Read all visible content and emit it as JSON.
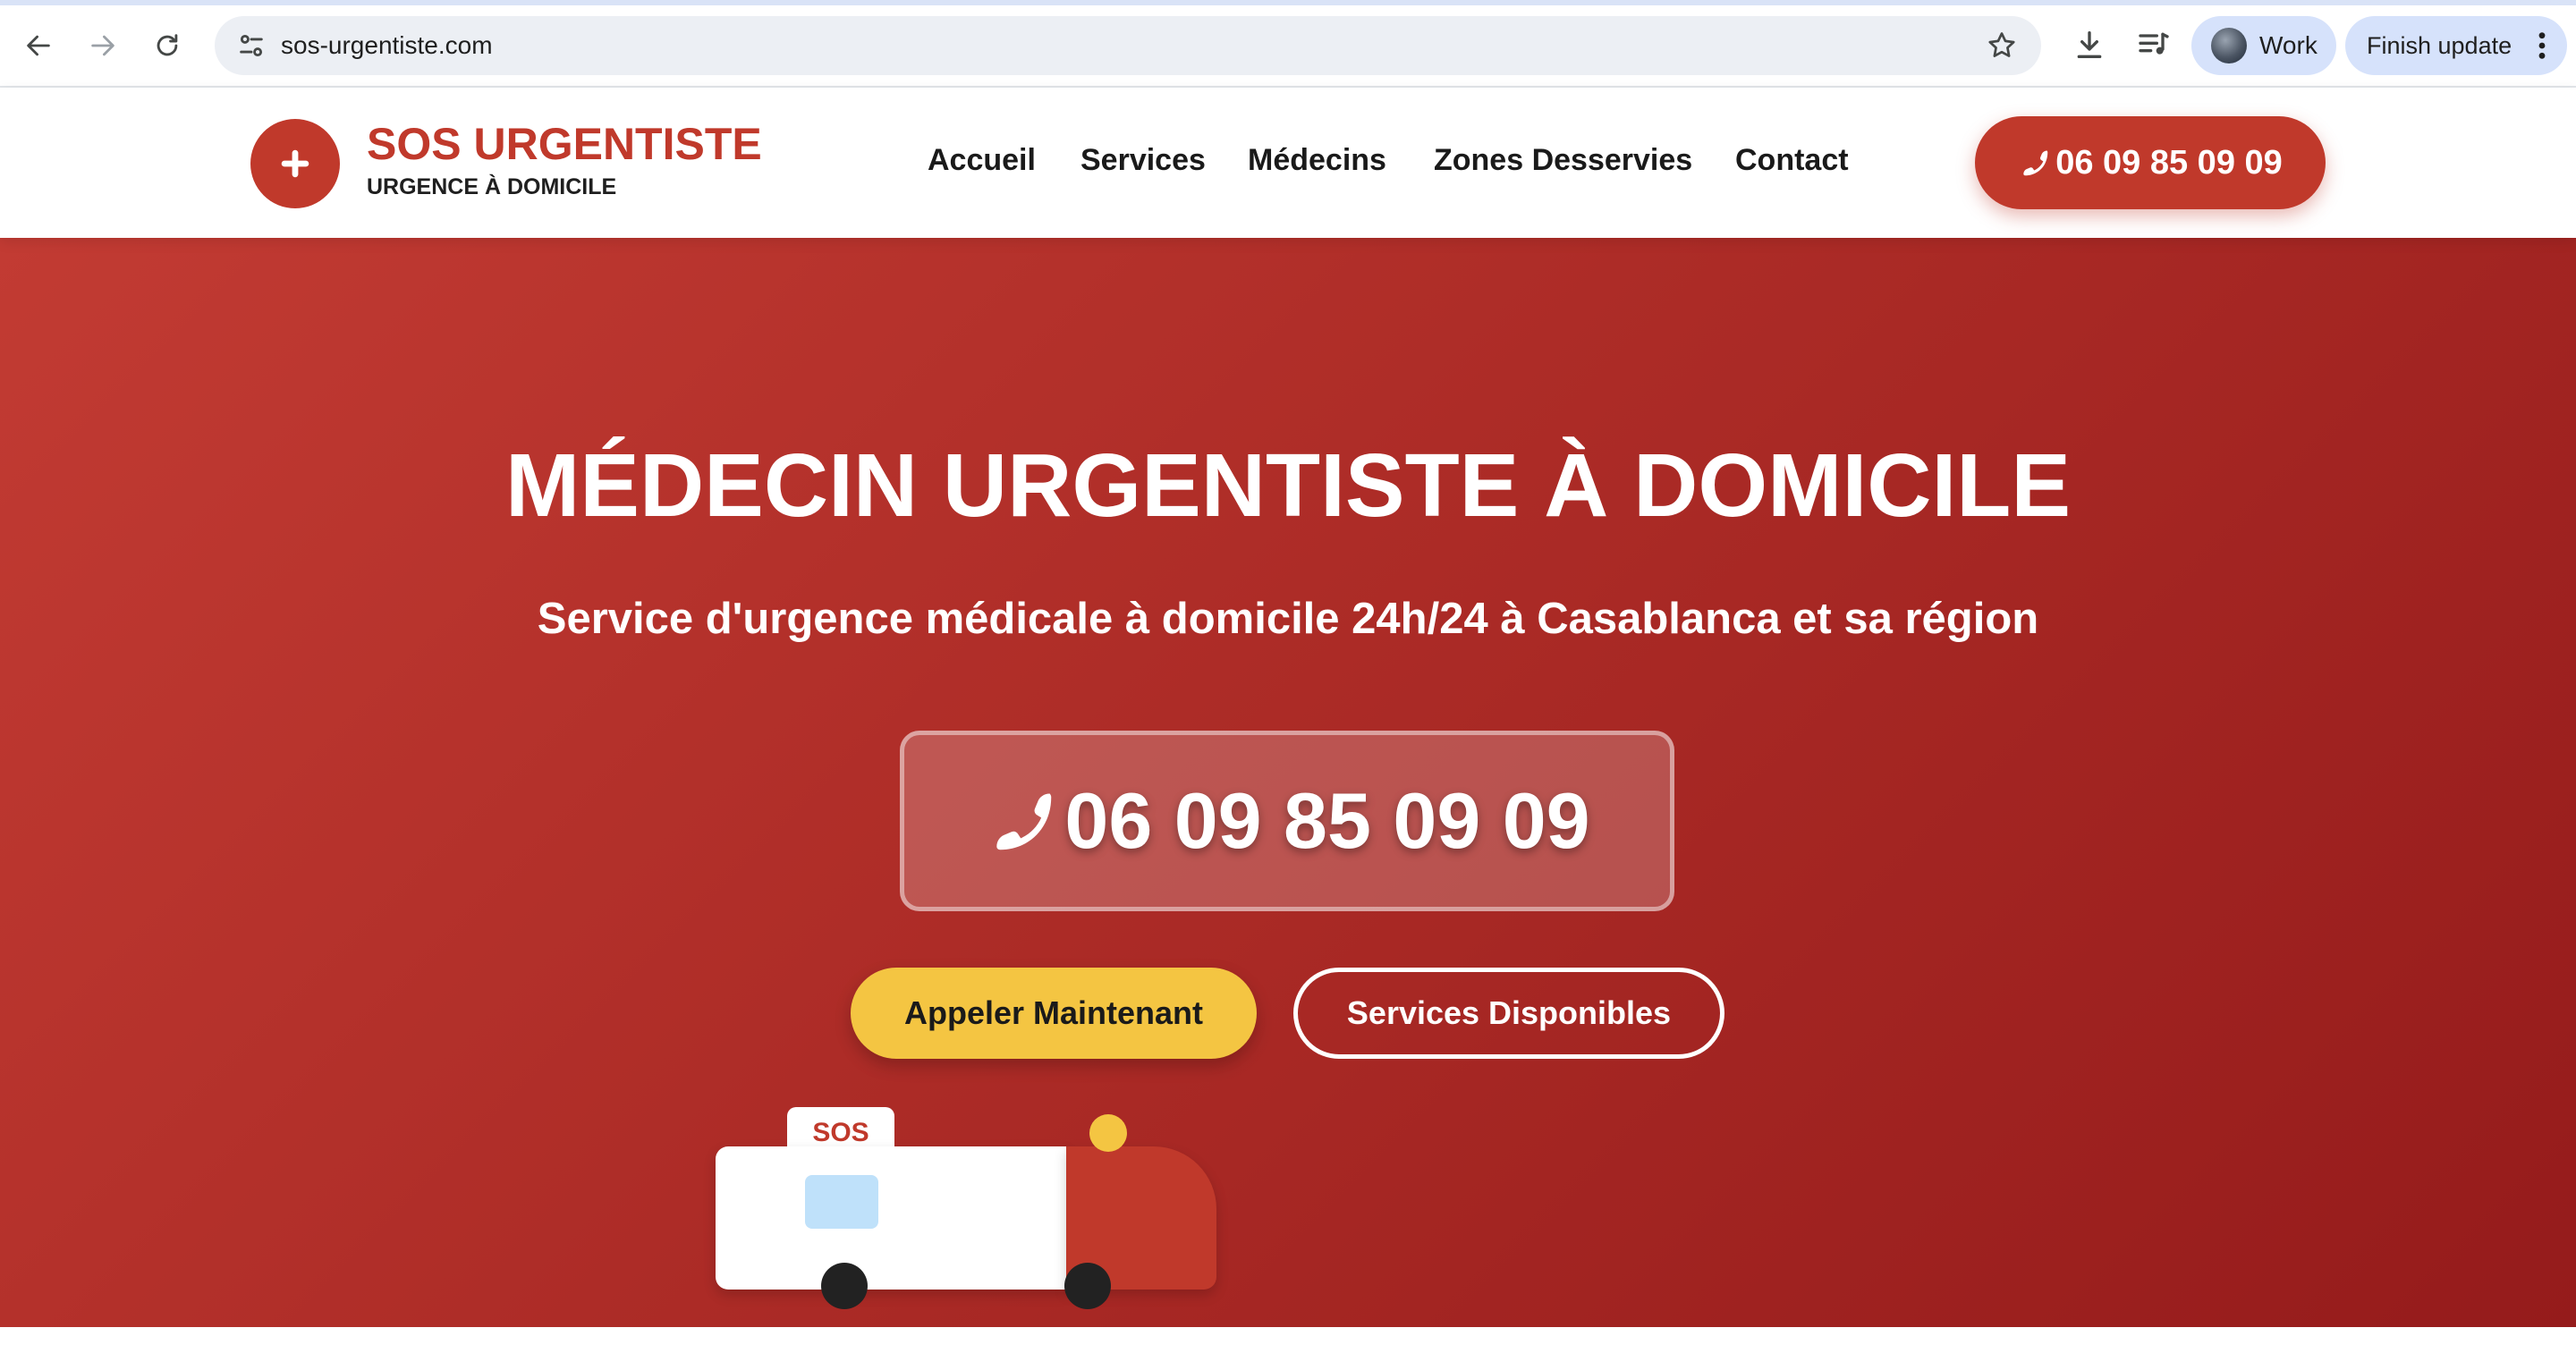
{
  "browser": {
    "url": "sos-urgentiste.com",
    "profile_label": "Work",
    "update_label": "Finish update",
    "icons": {
      "back": "arrow-left-icon",
      "forward": "arrow-right-icon",
      "reload": "reload-icon",
      "site_info": "tune-icon",
      "bookmark": "star-icon",
      "downloads": "download-icon",
      "media": "playlist-icon",
      "menu": "kebab-icon"
    }
  },
  "header": {
    "logo_title": "SOS URGENTISTE",
    "logo_subtitle": "URGENCE À DOMICILE",
    "nav": [
      "Accueil",
      "Services",
      "Médecins",
      "Zones Desservies",
      "Contact"
    ],
    "phone": "06 09 85 09 09"
  },
  "hero": {
    "title": "MÉDECIN URGENTISTE À DOMICILE",
    "subtitle": "Service d'urgence médicale à domicile 24h/24 à Casablanca et sa région",
    "phone": "06 09 85 09 09",
    "primary_button": "Appeler Maintenant",
    "secondary_button": "Services Disponibles",
    "ambulance_sign": "SOS"
  },
  "colors": {
    "brand_red": "#c0392b",
    "hero_gradient_start": "#c23b33",
    "hero_gradient_end": "#951b1b",
    "accent_yellow": "#f4c542",
    "chrome_chip": "#d6e2fb"
  }
}
